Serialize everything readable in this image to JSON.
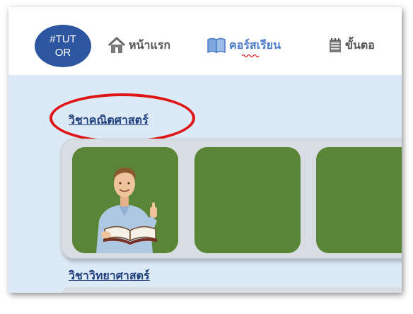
{
  "logo": {
    "text": "#TUTOR"
  },
  "nav": {
    "home_label": "หน้าแรก",
    "course_label": "คอร์สเรียน",
    "steps_label": "ขั้นตอ"
  },
  "sections": [
    {
      "title": "วิชาคณิตศาสตร์",
      "highlighted": true
    },
    {
      "title": "วิชาวิทยาศาสตร์"
    }
  ],
  "cards": [
    {
      "icon": "teacher-with-book-image"
    },
    {
      "icon": "blank-card"
    },
    {
      "icon": "blank-card"
    }
  ],
  "colors": {
    "logo": "#2c56a0",
    "course_link": "#4a7ac8",
    "content_bg": "#dce9f7",
    "card": "#5a8436",
    "highlight": "#e01616",
    "section_title": "#1f3f7c"
  }
}
